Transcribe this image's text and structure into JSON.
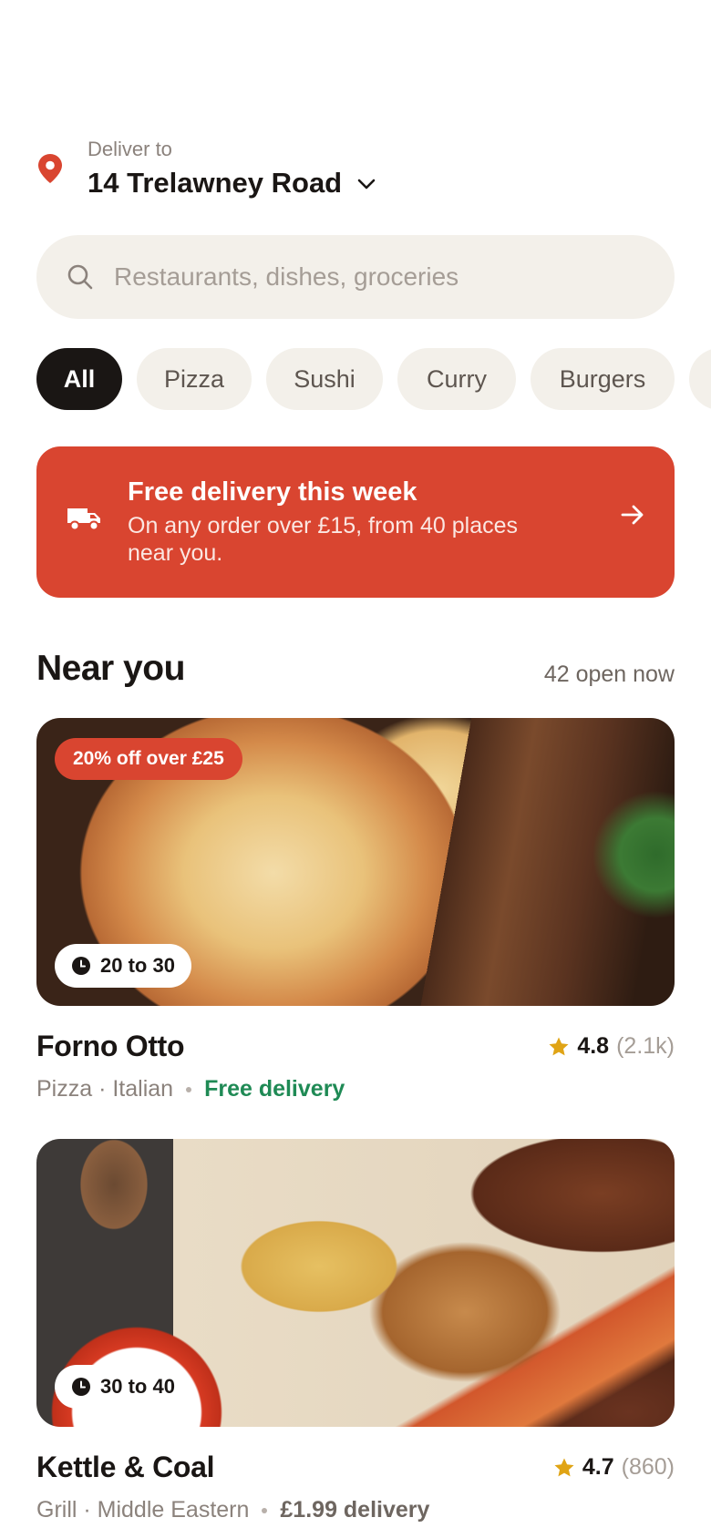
{
  "address": {
    "label": "Deliver to",
    "value": "14 Trelawney Road"
  },
  "search": {
    "placeholder": "Restaurants, dishes, groceries"
  },
  "categories": [
    "All",
    "Pizza",
    "Sushi",
    "Curry",
    "Burgers"
  ],
  "selected_category": "All",
  "promo": {
    "title": "Free delivery this week",
    "subtitle": "On any order over £15, from 40 places near you."
  },
  "section": {
    "title": "Near you",
    "count": "42 open now"
  },
  "restaurants": [
    {
      "name": "Forno Otto",
      "badge": "20% off over £25",
      "eta": "20 to 30",
      "rating": "4.8",
      "rating_count": "(2.1k)",
      "cuisine": "Pizza · Italian",
      "delivery": "Free delivery"
    },
    {
      "name": "Kettle & Coal",
      "eta": "30 to 40",
      "rating": "4.7",
      "rating_count": "(860)",
      "cuisine": "Grill · Middle Eastern",
      "delivery": "£1.99 delivery"
    }
  ],
  "colors": {
    "accent": "#d94530",
    "chip_bg": "#f3f0ea",
    "chip_active": "#1a1614",
    "free_delivery": "#1f8a55",
    "star": "#e0a415"
  },
  "icons": [
    "location-pin-icon",
    "chevron-down-icon",
    "search-icon",
    "truck-icon",
    "arrow-right-icon",
    "clock-icon",
    "star-icon"
  ]
}
